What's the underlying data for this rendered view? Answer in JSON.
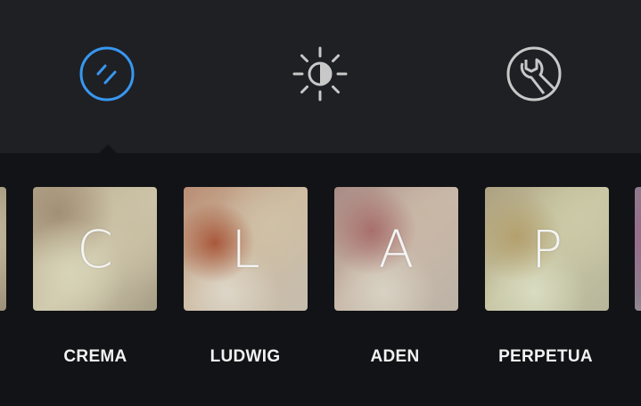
{
  "toolbar": {
    "tools": [
      {
        "id": "filter",
        "icon": "filter-icon",
        "active": true,
        "color": "#3897f0"
      },
      {
        "id": "lux",
        "icon": "lux-brightness-icon",
        "active": false,
        "color": "#c8c8c8"
      },
      {
        "id": "edit",
        "icon": "wrench-edit-icon",
        "active": false,
        "color": "#c8c8c8"
      }
    ]
  },
  "filters": [
    {
      "name": "CREMA",
      "letter": "C"
    },
    {
      "name": "LUDWIG",
      "letter": "L"
    },
    {
      "name": "ADEN",
      "letter": "A"
    },
    {
      "name": "PERPETUA",
      "letter": "P"
    }
  ],
  "colors": {
    "toolbar_bg": "#1e2024",
    "strip_bg": "#121316",
    "active_accent": "#3897f0",
    "inactive_icon": "#c8c8c8",
    "label_text": "#f2f2f2"
  }
}
